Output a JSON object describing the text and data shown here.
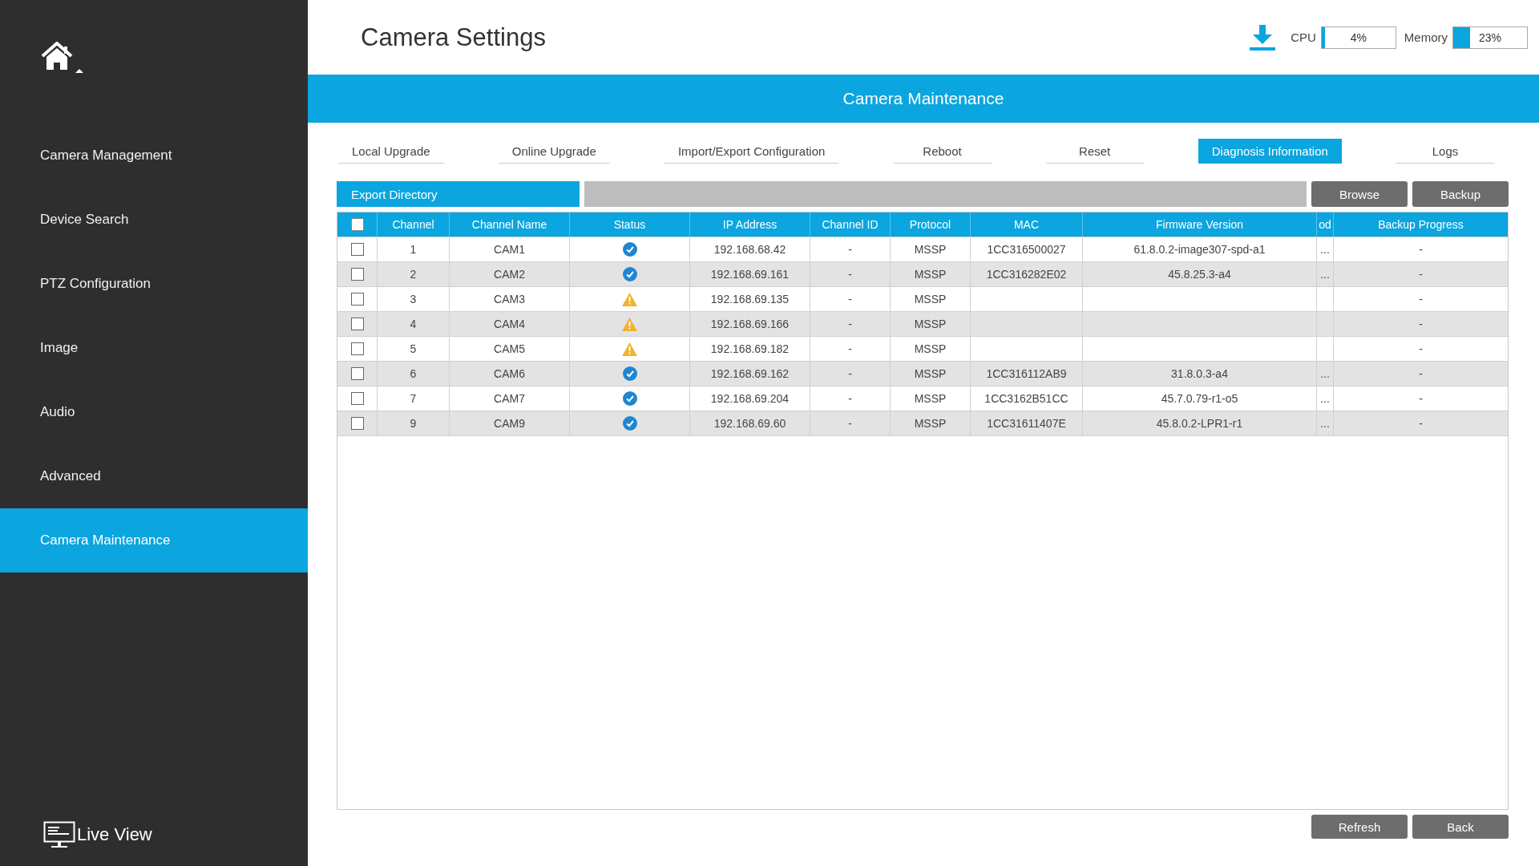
{
  "sidebar": {
    "items": [
      {
        "label": "Camera Management",
        "selected": false
      },
      {
        "label": "Device Search",
        "selected": false
      },
      {
        "label": "PTZ Configuration",
        "selected": false
      },
      {
        "label": "Image",
        "selected": false
      },
      {
        "label": "Audio",
        "selected": false
      },
      {
        "label": "Advanced",
        "selected": false
      },
      {
        "label": "Camera Maintenance",
        "selected": true
      }
    ],
    "live_view": "Live View"
  },
  "header": {
    "title": "Camera Settings",
    "cpu": {
      "label": "CPU",
      "level": 0.04,
      "reading": "4%"
    },
    "memory": {
      "label": "Memory",
      "level": 0.23,
      "reading": "23%"
    }
  },
  "banner": "Camera Maintenance",
  "tabs": [
    {
      "label": "Local Upgrade",
      "selected": false
    },
    {
      "label": "Online Upgrade",
      "selected": false
    },
    {
      "label": "Import/Export Configuration",
      "selected": false
    },
    {
      "label": "Reboot",
      "selected": false
    },
    {
      "label": "Reset",
      "selected": false
    },
    {
      "label": "Diagnosis Information",
      "selected": true
    },
    {
      "label": "Logs",
      "selected": false
    }
  ],
  "export": {
    "label": "Export Directory",
    "buttons": [
      "Browse",
      "Backup"
    ]
  },
  "table": {
    "header_checked": false,
    "columns": [
      "Channel",
      "Channel Name",
      "Status",
      "IP Address",
      "Channel ID",
      "Protocol",
      "MAC",
      "Firmware Version",
      "od",
      "Backup Progress"
    ],
    "rows": [
      {
        "checked": false,
        "channel": "1",
        "name": "CAM1",
        "warning": false,
        "ip": "192.168.68.42",
        "channel_id": "-",
        "protocol": "MSSP",
        "mac": "1CC316500027",
        "firmware": "61.8.0.2-image307-spd-a1",
        "column_9": "...",
        "progress": "-"
      },
      {
        "checked": false,
        "channel": "2",
        "name": "CAM2",
        "warning": false,
        "ip": "192.168.69.161",
        "channel_id": "-",
        "protocol": "MSSP",
        "mac": "1CC316282E02",
        "firmware": "45.8.25.3-a4",
        "column_9": "...",
        "progress": "-"
      },
      {
        "checked": false,
        "channel": "3",
        "name": "CAM3",
        "warning": true,
        "ip": "192.168.69.135",
        "channel_id": "-",
        "protocol": "MSSP",
        "progress": "-"
      },
      {
        "checked": false,
        "channel": "4",
        "name": "CAM4",
        "warning": true,
        "ip": "192.168.69.166",
        "channel_id": "-",
        "protocol": "MSSP",
        "progress": "-"
      },
      {
        "checked": false,
        "channel": "5",
        "name": "CAM5",
        "warning": true,
        "ip": "192.168.69.182",
        "channel_id": "-",
        "protocol": "MSSP",
        "progress": "-"
      },
      {
        "checked": false,
        "channel": "6",
        "name": "CAM6",
        "warning": false,
        "ip": "192.168.69.162",
        "channel_id": "-",
        "protocol": "MSSP",
        "mac": "1CC316112AB9",
        "firmware": "31.8.0.3-a4",
        "column_9": "...",
        "progress": "-"
      },
      {
        "checked": false,
        "channel": "7",
        "name": "CAM7",
        "warning": false,
        "ip": "192.168.69.204",
        "channel_id": "-",
        "protocol": "MSSP",
        "mac": "1CC3162B51CC",
        "firmware": "45.7.0.79-r1-o5",
        "column_9": "...",
        "progress": "-"
      },
      {
        "checked": false,
        "channel": "9",
        "name": "CAM9",
        "warning": false,
        "ip": "192.168.69.60",
        "channel_id": "-",
        "protocol": "MSSP",
        "mac": "1CC31611407E",
        "firmware": "45.8.0.2-LPR1-r1",
        "column_9": "...",
        "progress": "-"
      }
    ]
  },
  "footer_buttons": [
    "Refresh",
    "Back"
  ]
}
